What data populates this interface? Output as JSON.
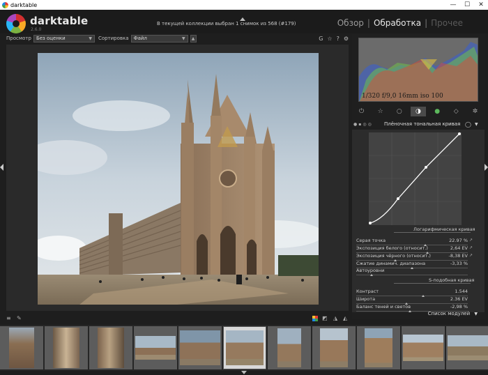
{
  "window": {
    "title": "darktable",
    "minimize": "—",
    "maximize": "☐",
    "close": "✕"
  },
  "header": {
    "brand": "darktable",
    "version": "2.6.0",
    "collection_info": "В текущей коллекции выбран 1 снимок из 568 (#179)",
    "views": {
      "lighttable": "Обзор",
      "separator": "|",
      "darkroom": "Обработка",
      "other": "Прочее"
    }
  },
  "filterbar": {
    "view_label": "Просмотр",
    "view_value": "Без оценки",
    "sort_label": "Сортировка",
    "sort_value": "Файл",
    "icons": [
      "G",
      "☆",
      "?",
      "⚙"
    ]
  },
  "histogram": {
    "exif": "1/320 f/9,0 16mm iso 100"
  },
  "module_groups": [
    "power-icon",
    "star-icon",
    "circle-icon",
    "tone-icon",
    "color-icon",
    "correct-icon",
    "effect-icon"
  ],
  "module": {
    "title": "Плёночная тональная кривая",
    "log_section": "Логарифмическая кривая",
    "rows": [
      {
        "label": "Серая точка",
        "value": "22.97 %",
        "marker": 0.62
      },
      {
        "label": "Экспозиция белого (относит.)",
        "value": "2,64 EV",
        "marker": 0.64
      },
      {
        "label": "Экспозиция чёрного (относит.)",
        "value": "-8,38 EV",
        "marker": 0.35
      },
      {
        "label": "Сжатие динамич. диапазона",
        "value": "-3,33 %",
        "marker": 0.5
      },
      {
        "label": "Автоуровни",
        "value": "",
        "marker": 0.14
      }
    ],
    "s_section": "S-подобная кривая",
    "s_rows": [
      {
        "label": "Контраст",
        "value": "1.544",
        "marker": 0.6
      },
      {
        "label": "Широта",
        "value": "2.36 EV",
        "marker": 0.45
      },
      {
        "label": "Баланс теней и светов",
        "value": "-2,98 %",
        "marker": 0.48
      }
    ]
  },
  "modlist_label": "Список модулей",
  "colors": {
    "accent": "#e0e0e0",
    "panel": "#2c2c2c",
    "background": "#1e1e1e"
  }
}
